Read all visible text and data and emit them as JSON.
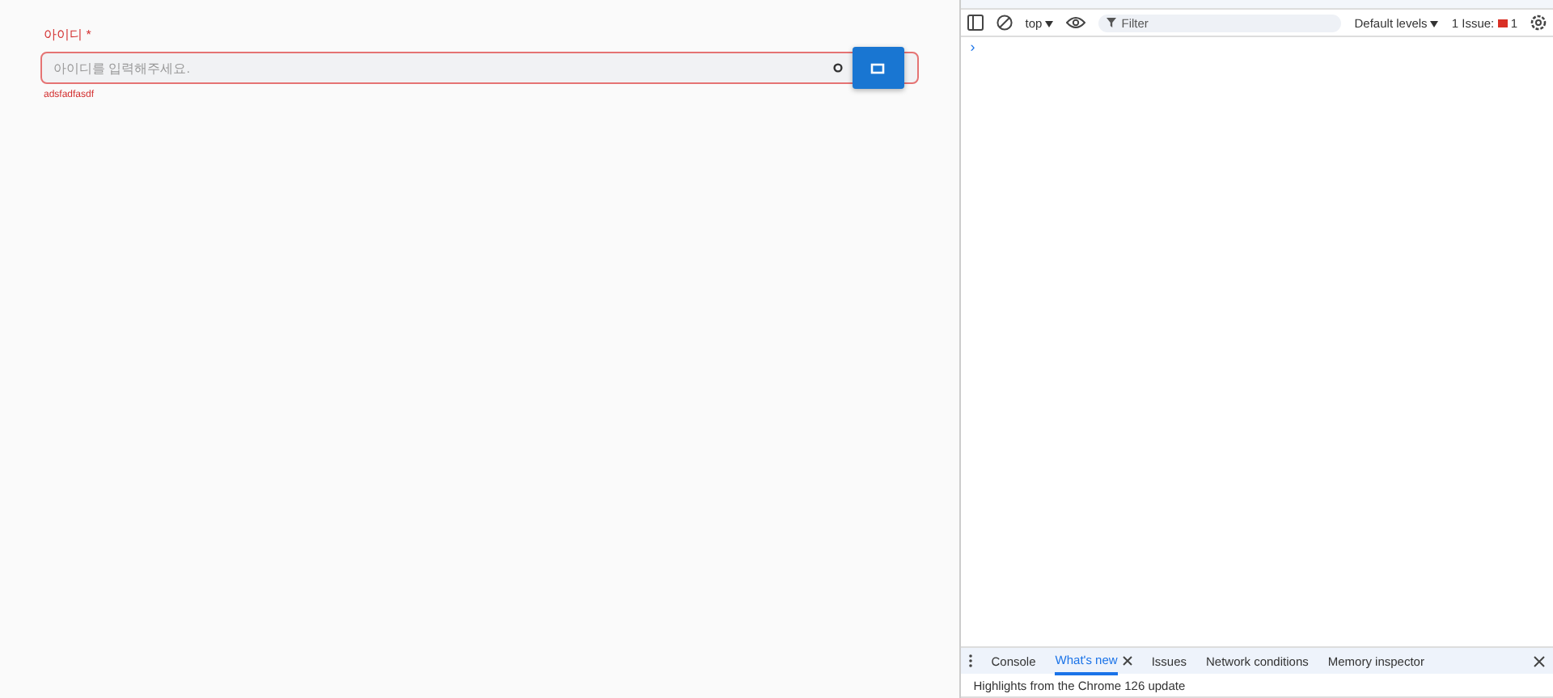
{
  "form": {
    "label": "아이디",
    "required_mark": "*",
    "placeholder": "아이디를 입력해주세요.",
    "error": "adsfadfasdf",
    "invalid": true
  },
  "console_toolbar": {
    "context": "top",
    "filter_placeholder": "Filter",
    "levels": "Default levels",
    "issues_label": "1 Issue:",
    "issues_count": "1"
  },
  "console_prompt": "›",
  "drawer_tabs": [
    {
      "label": "Console",
      "selected": false,
      "closable": false
    },
    {
      "label": "What's new",
      "selected": true,
      "closable": true
    },
    {
      "label": "Issues",
      "selected": false,
      "closable": false
    },
    {
      "label": "Network conditions",
      "selected": false,
      "closable": false
    },
    {
      "label": "Memory inspector",
      "selected": false,
      "closable": false
    }
  ],
  "drawer_content": "Highlights from the Chrome 126 update"
}
